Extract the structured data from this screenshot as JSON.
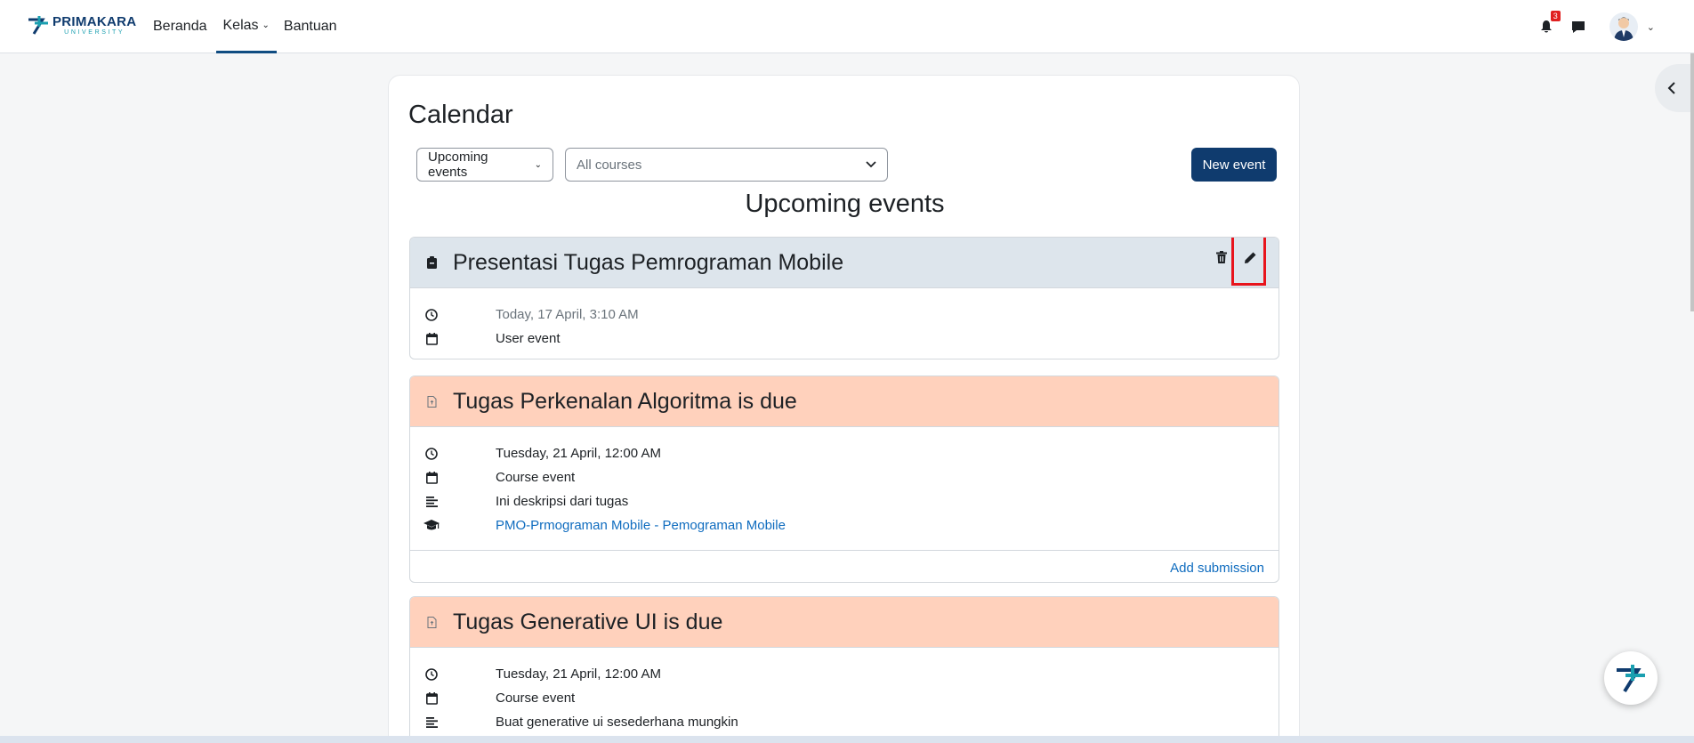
{
  "brand": {
    "name": "PRIMAKARA",
    "sub": "UNIVERSITY"
  },
  "nav": {
    "links": [
      {
        "label": "Beranda"
      },
      {
        "label": "Kelas"
      },
      {
        "label": "Bantuan"
      }
    ],
    "notification_count": "3"
  },
  "page": {
    "title": "Calendar",
    "view_select": "Upcoming events",
    "course_select": "All courses",
    "new_event": "New event",
    "section_title": "Upcoming events"
  },
  "events": [
    {
      "title": "Presentasi Tugas Pemrograman Mobile",
      "kind": "user",
      "time": "Today, 17 April, 3:10 AM",
      "type": "User event"
    },
    {
      "title": "Tugas Perkenalan Algoritma is due",
      "kind": "course",
      "time": "Tuesday, 21 April, 12:00 AM",
      "type": "Course event",
      "description": "Ini deskripsi dari tugas",
      "course": "PMO-Prmograman Mobile - Pemograman Mobile",
      "action": "Add submission"
    },
    {
      "title": "Tugas Generative UI is due",
      "kind": "course",
      "time": "Tuesday, 21 April, 12:00 AM",
      "type": "Course event",
      "description": "Buat generative ui sesederhana mungkin"
    }
  ],
  "colors": {
    "primary": "#0f3b6e",
    "user_event": "#dde5ec",
    "course_event": "#ffd1bc",
    "highlight": "#e8141c",
    "link": "#0f6cbf"
  }
}
